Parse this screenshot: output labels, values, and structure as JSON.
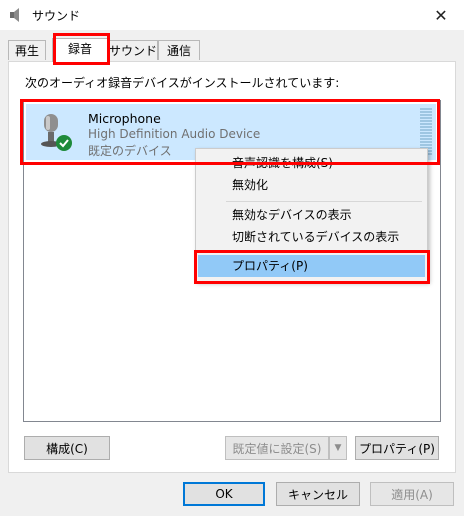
{
  "window": {
    "title": "サウンド"
  },
  "tabs": [
    "再生",
    "録音",
    "サウンド",
    "通信"
  ],
  "caption": "次のオーディオ録音デバイスがインストールされています:",
  "device": {
    "name": "Microphone",
    "description": "High Definition Audio Device",
    "status": "既定のデバイス"
  },
  "context_menu": {
    "items": [
      "音声認識を構成(S)",
      "無効化",
      "無効なデバイスの表示",
      "切断されているデバイスの表示",
      "プロパティ(P)"
    ],
    "highlighted": "プロパティ(P)"
  },
  "panel_buttons": {
    "configure": "構成(C)",
    "set_default": "既定値に設定(S)",
    "properties": "プロパティ(P)"
  },
  "dialog_buttons": {
    "ok": "OK",
    "cancel": "キャンセル",
    "apply": "適用(A)"
  },
  "colors": {
    "selection": "#cce8ff",
    "menu_highlight": "#91c9f7",
    "annotation": "#ff0000",
    "check_badge": "#1e8a3a"
  }
}
